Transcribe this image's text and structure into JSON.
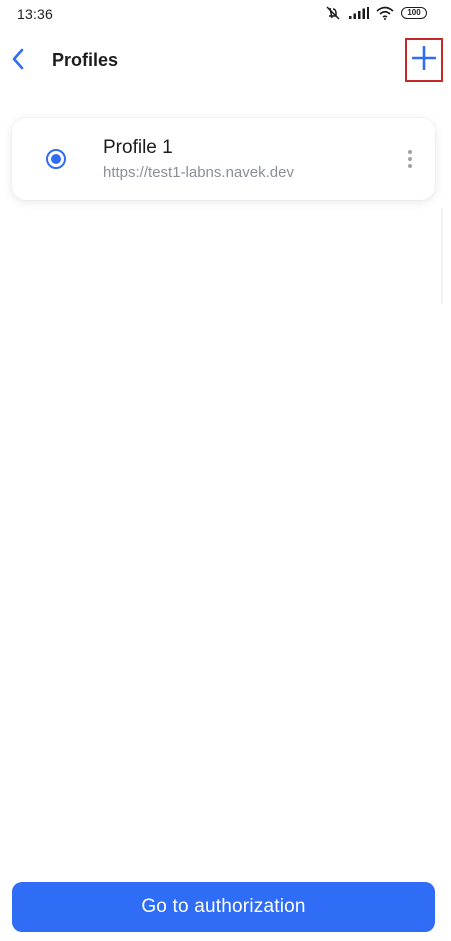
{
  "status_bar": {
    "time": "13:36",
    "battery": "100",
    "icons": [
      "vibrate-off-icon",
      "signal-icon",
      "wifi-icon",
      "battery-icon"
    ]
  },
  "header": {
    "title": "Profiles",
    "back_icon": "chevron-left-icon",
    "add_icon": "plus-icon"
  },
  "profiles": [
    {
      "name": "Profile 1",
      "url": "https://test1-labns.navek.dev",
      "selected": true
    }
  ],
  "footer": {
    "primary_button_label": "Go to authorization"
  },
  "colors": {
    "accent": "#2f6df6",
    "highlight_border": "#c62828",
    "secondary_text": "#8a8f98"
  }
}
